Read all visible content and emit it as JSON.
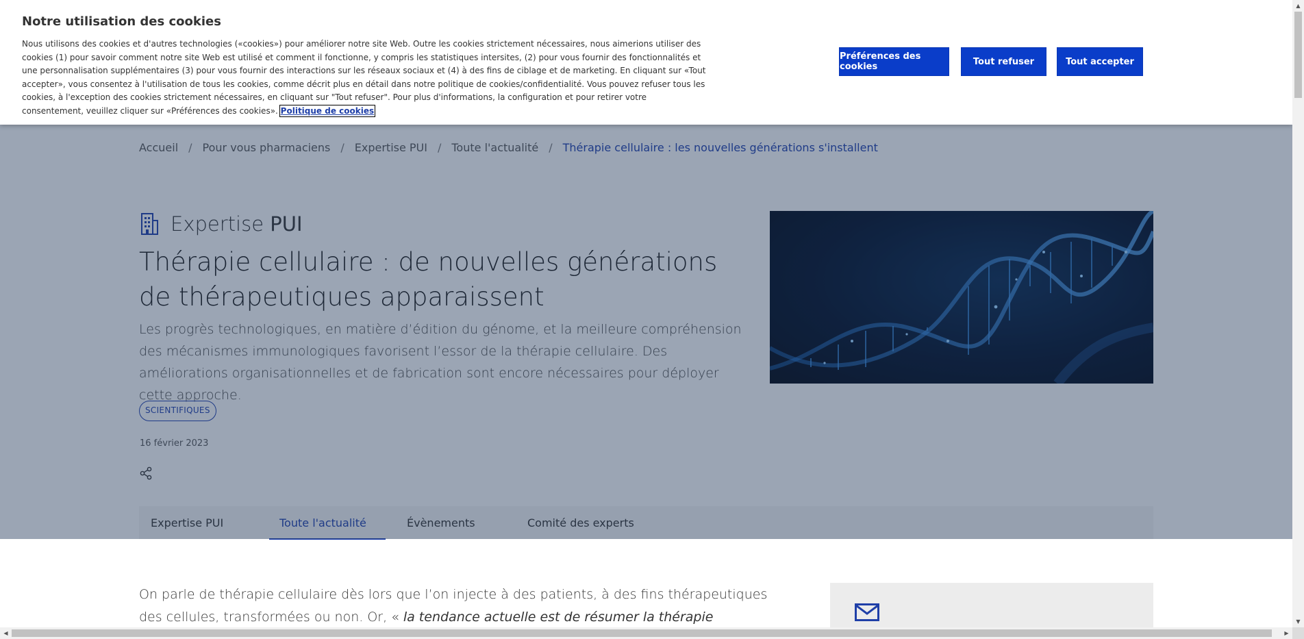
{
  "cookie_banner": {
    "title": "Notre utilisation des cookies",
    "text": "Nous utilisons des cookies et d'autres technologies («cookies») pour améliorer notre site Web. Outre les cookies strictement nécessaires, nous aimerions utiliser des cookies (1) pour savoir comment notre site Web est utilisé et comment il fonctionne, y compris les statistiques intersites, (2) pour vous fournir des fonctionnalités et une personnalisation supplémentaires (3) pour vous fournir des interactions sur les réseaux sociaux et (4) à des fins de ciblage et de marketing. En cliquant sur «Tout accepter», vous consentez à l'utilisation de tous les cookies, comme décrit plus en détail dans notre politique de cookies/confidentialité. Vous pouvez refuser tous les cookies, à l'exception des cookies strictement nécessaires, en cliquant sur \"Tout refuser\". Pour plus d'informations, la configuration et pour retirer votre consentement, veuillez cliquer sur «Préférences des cookies». ",
    "link_label": "Politique de cookies",
    "preferences_label": "Préférences des cookies",
    "refuse_label": "Tout refuser",
    "accept_label": "Tout accepter",
    "button_color": "#0a3dc9"
  },
  "breadcrumb": {
    "items": [
      "Accueil",
      "Pour vous pharmaciens",
      "Expertise PUI",
      "Toute l'actualité"
    ],
    "separator": "/",
    "current": "Thérapie cellulaire : les nouvelles générations s'installent"
  },
  "section": {
    "icon": "building-icon",
    "prefix": "Expertise ",
    "name": "PUI"
  },
  "article": {
    "title": "Thérapie cellulaire : de nouvelles générations de thérapeutiques apparaissent",
    "lead": "Les progrès technologiques, en matière d’édition du génome, et la meilleure compréhension des mécanismes immunologiques favorisent l’essor de la thérapie cellulaire. Des améliorations organisationnelles et de fabrication sont encore nécessaires pour déployer cette approche.",
    "tag": "SCIENTIFIQUES",
    "date": "16 février 2023",
    "share_icon": "share-icon",
    "body_start": "On parle de thérapie cellulaire dès lors que l’on injecte à des patients, à des fins thérapeutiques des cellules, transformées ou non. Or, « ",
    "body_italic": "la tendance actuelle est de résumer la thérapie cellulaire aux cellules génétiquement"
  },
  "tabs": [
    {
      "label": "Expertise PUI",
      "active": false
    },
    {
      "label": "Toute l'actualité",
      "active": true
    },
    {
      "label": "Évènements",
      "active": false
    },
    {
      "label": "Comité des experts",
      "active": false
    }
  ],
  "sidebar": {
    "icon": "mail-icon"
  },
  "colors": {
    "accent": "#1f3fa8",
    "overlay": "rgba(30,55,90,0.42)"
  }
}
